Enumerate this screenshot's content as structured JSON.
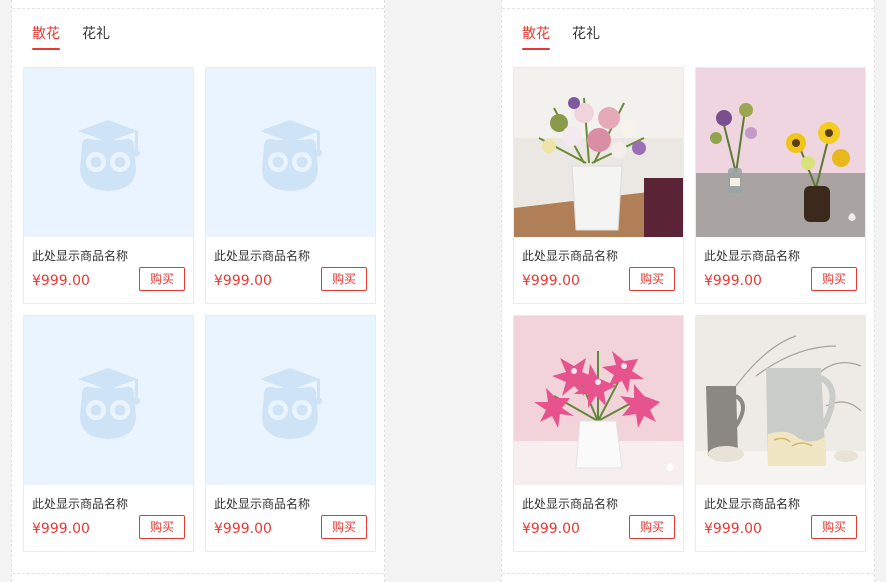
{
  "colors": {
    "accent": "#e53935",
    "placeholder_bg": "#eaf4fe",
    "placeholder_icon": "#cfe3f7"
  },
  "panels": [
    {
      "tabs": [
        {
          "label": "散花",
          "active": true
        },
        {
          "label": "花礼",
          "active": false
        }
      ],
      "products": [
        {
          "name": "此处显示商品名称",
          "price": "¥999.00",
          "buy_label": "购买",
          "image": "owl-placeholder-icon"
        },
        {
          "name": "此处显示商品名称",
          "price": "¥999.00",
          "buy_label": "购买",
          "image": "owl-placeholder-icon"
        },
        {
          "name": "此处显示商品名称",
          "price": "¥999.00",
          "buy_label": "购买",
          "image": "owl-placeholder-icon"
        },
        {
          "name": "此处显示商品名称",
          "price": "¥999.00",
          "buy_label": "购买",
          "image": "owl-placeholder-icon"
        }
      ]
    },
    {
      "tabs": [
        {
          "label": "散花",
          "active": true
        },
        {
          "label": "花礼",
          "active": false
        }
      ],
      "products": [
        {
          "name": "此处显示商品名称",
          "price": "¥999.00",
          "buy_label": "购买",
          "image": "flower-bouquet-white-vase-photo"
        },
        {
          "name": "此处显示商品名称",
          "price": "¥999.00",
          "buy_label": "购买",
          "image": "sunflower-bottles-photo"
        },
        {
          "name": "此处显示商品名称",
          "price": "¥999.00",
          "buy_label": "购买",
          "image": "pink-lily-vase-photo"
        },
        {
          "name": "此处显示商品名称",
          "price": "¥999.00",
          "buy_label": "购买",
          "image": "ceramic-pitchers-photo"
        }
      ]
    }
  ]
}
